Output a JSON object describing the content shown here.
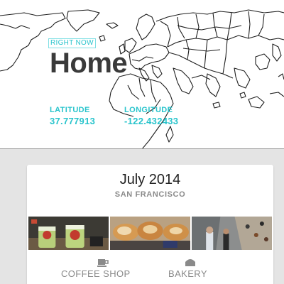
{
  "hero": {
    "tag": "RIGHT NOW",
    "title": "Home",
    "latitude_label": "LATITUDE",
    "longitude_label": "LONGITUDE",
    "latitude_value": "37.777913",
    "longitude_value": "-122.432433",
    "accent_color": "#29c4cc"
  },
  "card": {
    "title": "July 2014",
    "subtitle": "SAN FRANCISCO",
    "photos": [
      "smoothies-photo",
      "pastries-photo",
      "climbing-gym-photo"
    ],
    "categories": [
      {
        "label": "COFFEE SHOP",
        "icon": "coffee-cup-icon"
      },
      {
        "label": "BAKERY",
        "icon": "bakery-icon"
      }
    ]
  }
}
